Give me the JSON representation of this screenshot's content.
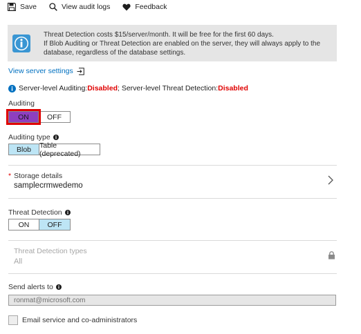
{
  "toolbar": {
    "save": "Save",
    "audit_logs": "View audit logs",
    "feedback": "Feedback"
  },
  "banner": {
    "line1": "Threat Detection costs $15/server/month. It will be free for the first 60 days.",
    "line2": "If Blob Auditing or Threat Detection are enabled on the server, they will always apply to the",
    "line3": "database, regardless of the database settings."
  },
  "server_link": "View server settings",
  "status": {
    "prefix": "Server-level Auditing: ",
    "auditing_value": "Disabled",
    "middle": "; Server-level Threat Detection: ",
    "threat_value": "Disabled"
  },
  "auditing": {
    "label": "Auditing",
    "on": "ON",
    "off": "OFF",
    "selected": "ON"
  },
  "auditing_type": {
    "label": "Auditing type",
    "blob": "Blob",
    "table": "Table (deprecated)",
    "selected": "Blob"
  },
  "storage": {
    "required_mark": "*",
    "label": "Storage details",
    "value": "samplecrmwedemo"
  },
  "threat_detection": {
    "label": "Threat Detection",
    "on": "ON",
    "off": "OFF",
    "selected": "OFF"
  },
  "threat_types": {
    "label": "Threat Detection types",
    "value": "All"
  },
  "alerts": {
    "label": "Send alerts to",
    "email": "ronmat@microsoft.com"
  },
  "email_admins": {
    "label": "Email service and co-administrators",
    "checked": false
  },
  "colors": {
    "accent_blue": "#0070c0",
    "disabled_red": "#e00000",
    "selected_toggle": "#bde5f5",
    "on_highlight": "#8e3fc0"
  }
}
